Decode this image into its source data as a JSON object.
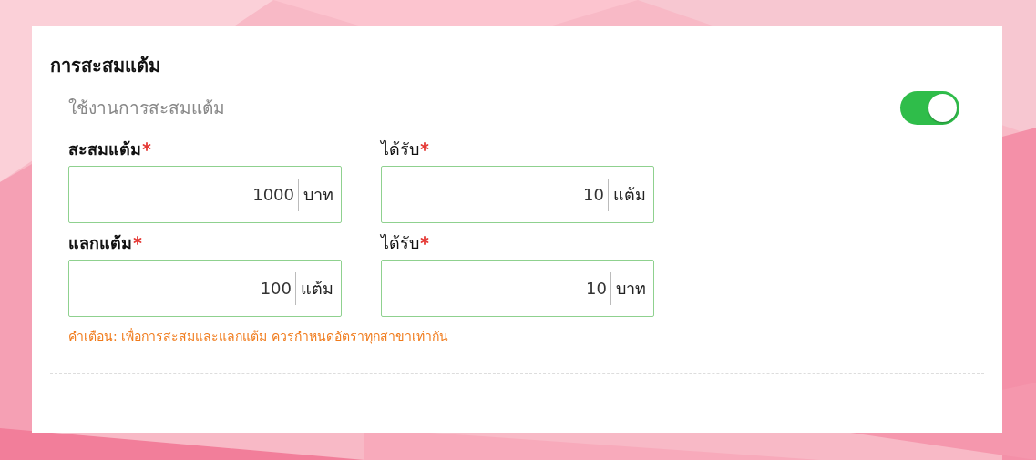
{
  "section": {
    "title": "การสะสมแต้ม"
  },
  "toggle": {
    "label": "ใช้งานการสะสมแต้ม",
    "on": true
  },
  "rows": [
    {
      "fields": [
        {
          "label": "สะสมแต้ม",
          "required": true,
          "value": "1000",
          "unit": "บาท"
        },
        {
          "label": "ได้รับ",
          "required": true,
          "value": "10",
          "unit": "แต้ม"
        }
      ]
    },
    {
      "fields": [
        {
          "label": "แลกแต้ม",
          "required": true,
          "value": "100",
          "unit": "แต้ม"
        },
        {
          "label": "ได้รับ",
          "required": true,
          "value": "10",
          "unit": "บาท"
        }
      ]
    }
  ],
  "warning": "คำเตือน: เพื่อการสะสมและแลกแต้ม ควรกำหนดอัตราทุกสาขาเท่ากัน"
}
